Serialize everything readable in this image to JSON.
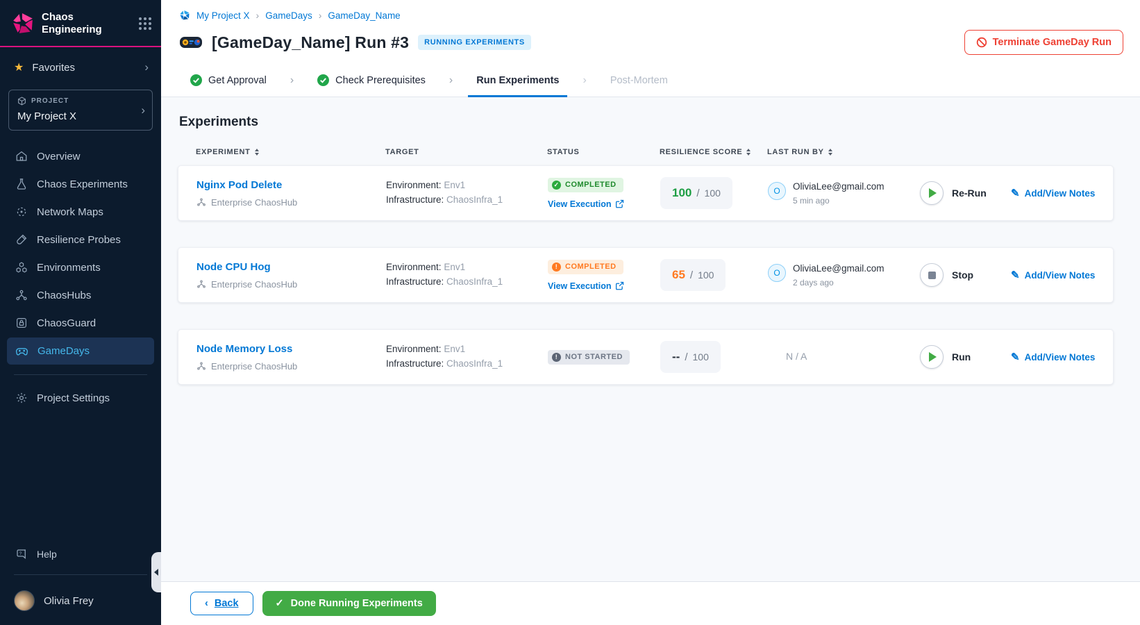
{
  "colors": {
    "sidebar_bg": "#0c1b2d",
    "brand_pink": "#da127e",
    "primary_blue": "#0278d5",
    "active_nav_blue": "#45b7ea",
    "success_green": "#2bab3e",
    "score_green": "#1e9e44",
    "warning_orange": "#ff7a21",
    "danger_red": "#ee4134",
    "done_button_green": "#42ab45"
  },
  "icons": {
    "check": "✓",
    "exclaim": "!",
    "pencil": "✎",
    "chevron_right": "›",
    "chevron_left": "‹"
  },
  "sidebar": {
    "brand": {
      "title": "Chaos Engineering"
    },
    "favorites_label": "Favorites",
    "project": {
      "eyebrow": "PROJECT",
      "name": "My Project X"
    },
    "nav": [
      {
        "label": "Overview",
        "icon": "home-icon"
      },
      {
        "label": "Chaos Experiments",
        "icon": "flask-icon"
      },
      {
        "label": "Network Maps",
        "icon": "network-icon"
      },
      {
        "label": "Resilience Probes",
        "icon": "probe-icon"
      },
      {
        "label": "Environments",
        "icon": "environments-icon"
      },
      {
        "label": "ChaosHubs",
        "icon": "hub-icon"
      },
      {
        "label": "ChaosGuard",
        "icon": "lock-icon"
      },
      {
        "label": "GameDays",
        "icon": "gamepad-icon",
        "active": true
      }
    ],
    "settings_label": "Project Settings",
    "help_label": "Help",
    "user": {
      "name": "Olivia Frey"
    }
  },
  "header": {
    "breadcrumb": [
      "My Project X",
      "GameDays",
      "GameDay_Name"
    ],
    "title": "[GameDay_Name] Run #3",
    "status_badge": "RUNNING EXPERIMENTS",
    "terminate_label": "Terminate GameDay Run"
  },
  "stepper": {
    "steps": [
      {
        "label": "Get Approval",
        "state": "done"
      },
      {
        "label": "Check Prerequisites",
        "state": "done"
      },
      {
        "label": "Run Experiments",
        "state": "active"
      },
      {
        "label": "Post-Mortem",
        "state": "upcoming"
      }
    ]
  },
  "main": {
    "heading": "Experiments",
    "table": {
      "columns": [
        {
          "label": "EXPERIMENT",
          "sortable": true
        },
        {
          "label": "TARGET",
          "sortable": false
        },
        {
          "label": "STATUS",
          "sortable": false
        },
        {
          "label": "RESILIENCE SCORE",
          "sortable": true
        },
        {
          "label": "LAST RUN BY",
          "sortable": true
        }
      ],
      "rows": [
        {
          "name": "Nginx Pod Delete",
          "hub": "Enterprise ChaosHub",
          "environment_label": "Environment:",
          "environment": "Env1",
          "infrastructure_label": "Infrastructure:",
          "infrastructure": "ChaosInfra_1",
          "status": "COMPLETED",
          "status_kind": "success",
          "view_execution": "View Execution",
          "score": "100",
          "score_sep": "/",
          "score_max": "100",
          "runner_initial": "O",
          "runner_email": "OliviaLee@gmail.com",
          "runner_time": "5 min ago",
          "action": "Re-Run",
          "notes": "Add/View Notes"
        },
        {
          "name": "Node CPU Hog",
          "hub": "Enterprise ChaosHub",
          "environment_label": "Environment:",
          "environment": "Env1",
          "infrastructure_label": "Infrastructure:",
          "infrastructure": "ChaosInfra_1",
          "status": "COMPLETED",
          "status_kind": "warning",
          "view_execution": "View Execution",
          "score": "65",
          "score_sep": "/",
          "score_max": "100",
          "runner_initial": "O",
          "runner_email": "OliviaLee@gmail.com",
          "runner_time": "2 days ago",
          "action": "Stop",
          "notes": "Add/View Notes"
        },
        {
          "name": "Node Memory Loss",
          "hub": "Enterprise ChaosHub",
          "environment_label": "Environment:",
          "environment": "Env1",
          "infrastructure_label": "Infrastructure:",
          "infrastructure": "ChaosInfra_1",
          "status": "NOT STARTED",
          "status_kind": "neutral",
          "score": "--",
          "score_sep": "/",
          "score_max": "100",
          "runner_na": "N / A",
          "action": "Run",
          "notes": "Add/View Notes"
        }
      ]
    }
  },
  "footer": {
    "back_label": "Back",
    "done_label": "Done Running Experiments"
  }
}
